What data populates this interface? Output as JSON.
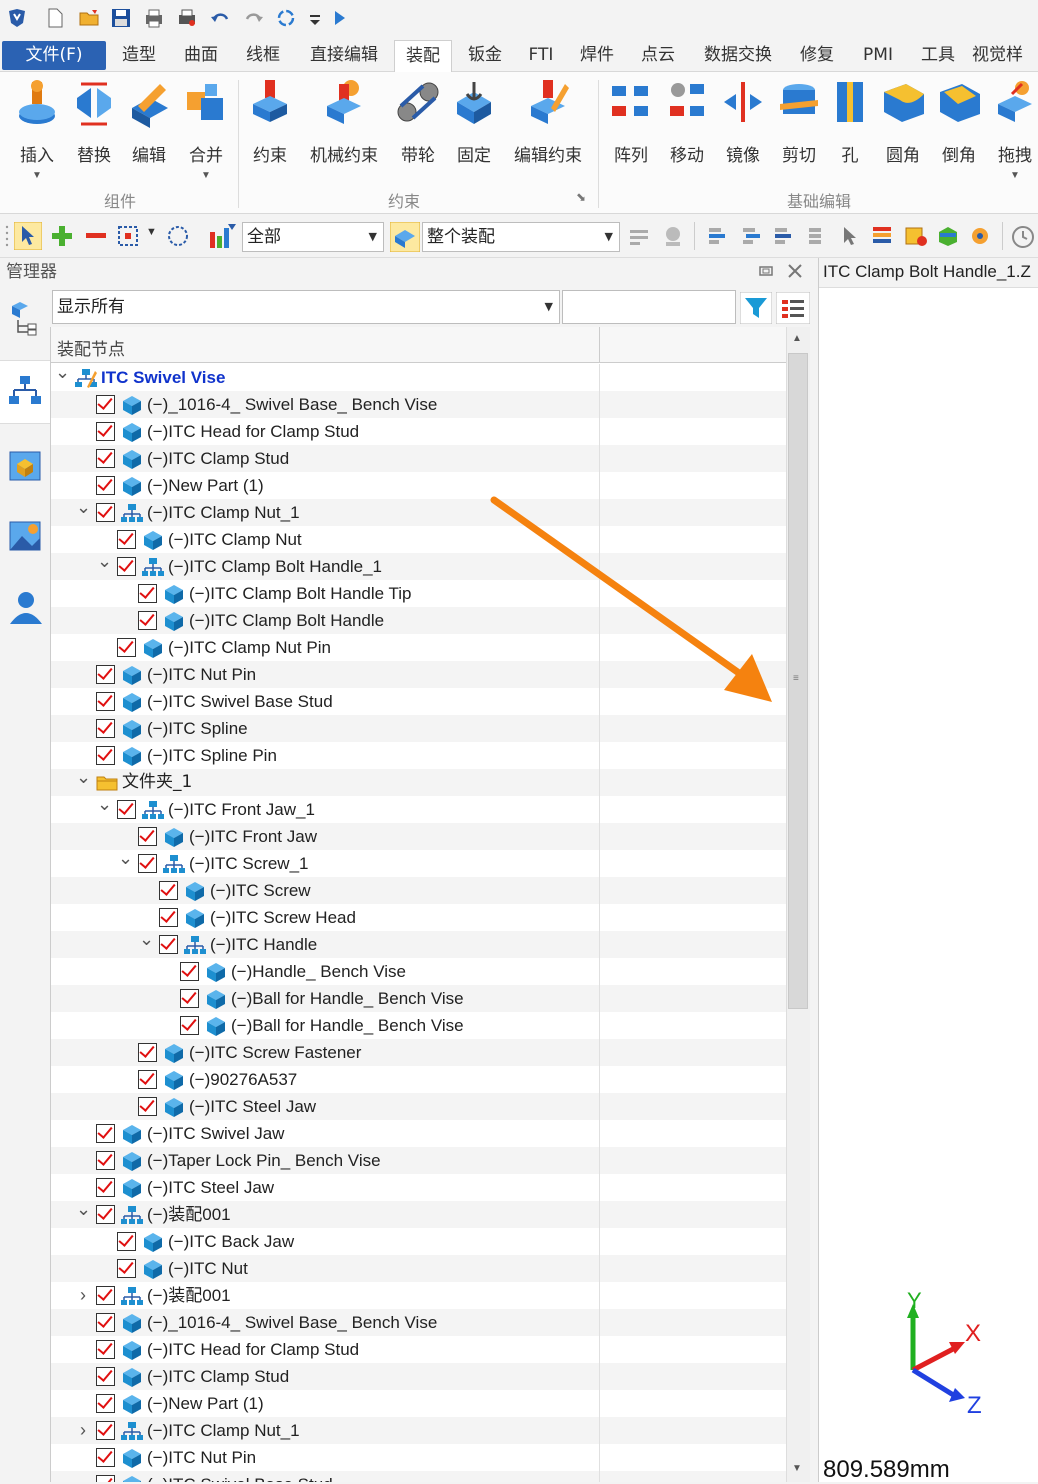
{
  "menu_tabs": [
    "文件(F)",
    "造型",
    "曲面",
    "线框",
    "直接编辑",
    "装配",
    "钣金",
    "FTI",
    "焊件",
    "点云",
    "数据交换",
    "修复",
    "PMI",
    "工具",
    "视觉样"
  ],
  "ribbon": {
    "group_component": {
      "label": "组件",
      "buttons": [
        "插入",
        "替换",
        "编辑",
        "合并"
      ]
    },
    "group_constraint": {
      "label": "约束",
      "buttons": [
        "约束",
        "机械约束",
        "带轮",
        "固定",
        "编辑约束"
      ]
    },
    "group_basic_edit": {
      "label": "基础编辑",
      "buttons": [
        "阵列",
        "移动",
        "镜像",
        "剪切",
        "孔",
        "圆角",
        "倒角",
        "拖拽"
      ]
    }
  },
  "toolbar": {
    "filter_combo": "全部",
    "scope_combo": "整个装配"
  },
  "manager": {
    "title": "管理器",
    "filter_dropdown": "显示所有",
    "column_header": "装配节点"
  },
  "viewport": {
    "tab_title": "ITC Clamp Bolt Handle_1.Z",
    "axis_x": "X",
    "axis_y": "Y",
    "axis_z": "Z",
    "measurement": "809.589mm"
  },
  "tree": [
    {
      "label": "ITC Swivel Vise",
      "level": 0,
      "type": "root",
      "expand": "open"
    },
    {
      "label": "(−)_1016-4_ Swivel Base_ Bench Vise",
      "level": 1,
      "type": "part"
    },
    {
      "label": "(−)ITC Head for Clamp Stud",
      "level": 1,
      "type": "part"
    },
    {
      "label": "(−)ITC Clamp Stud",
      "level": 1,
      "type": "part"
    },
    {
      "label": "(−)New Part (1)",
      "level": 1,
      "type": "part"
    },
    {
      "label": "(−)ITC Clamp Nut_1",
      "level": 1,
      "type": "asm",
      "expand": "open"
    },
    {
      "label": "(−)ITC Clamp Nut",
      "level": 2,
      "type": "part"
    },
    {
      "label": "(−)ITC Clamp Bolt Handle_1",
      "level": 2,
      "type": "asm",
      "expand": "open"
    },
    {
      "label": "(−)ITC Clamp Bolt Handle Tip",
      "level": 3,
      "type": "part"
    },
    {
      "label": "(−)ITC Clamp Bolt Handle",
      "level": 3,
      "type": "part"
    },
    {
      "label": "(−)ITC Clamp Nut Pin",
      "level": 2,
      "type": "part"
    },
    {
      "label": "(−)ITC Nut Pin",
      "level": 1,
      "type": "part"
    },
    {
      "label": "(−)ITC Swivel Base Stud",
      "level": 1,
      "type": "part"
    },
    {
      "label": "(−)ITC Spline",
      "level": 1,
      "type": "part"
    },
    {
      "label": "(−)ITC Spline Pin",
      "level": 1,
      "type": "part"
    },
    {
      "label": "文件夹_1",
      "level": 1,
      "type": "folder",
      "expand": "open"
    },
    {
      "label": "(−)ITC Front Jaw_1",
      "level": 2,
      "type": "asm",
      "expand": "open"
    },
    {
      "label": "(−)ITC Front Jaw",
      "level": 3,
      "type": "part"
    },
    {
      "label": "(−)ITC Screw_1",
      "level": 3,
      "type": "asm",
      "expand": "open"
    },
    {
      "label": "(−)ITC Screw",
      "level": 4,
      "type": "part"
    },
    {
      "label": "(−)ITC Screw Head",
      "level": 4,
      "type": "part"
    },
    {
      "label": "(−)ITC Handle",
      "level": 4,
      "type": "asm",
      "expand": "open"
    },
    {
      "label": "(−)Handle_ Bench Vise",
      "level": 5,
      "type": "part"
    },
    {
      "label": "(−)Ball for Handle_ Bench Vise",
      "level": 5,
      "type": "part"
    },
    {
      "label": "(−)Ball for Handle_ Bench Vise",
      "level": 5,
      "type": "part"
    },
    {
      "label": "(−)ITC Screw Fastener",
      "level": 3,
      "type": "part"
    },
    {
      "label": "(−)90276A537",
      "level": 3,
      "type": "part"
    },
    {
      "label": "(−)ITC Steel Jaw",
      "level": 3,
      "type": "part"
    },
    {
      "label": "(−)ITC Swivel Jaw",
      "level": 1,
      "type": "part"
    },
    {
      "label": "(−)Taper Lock Pin_ Bench Vise",
      "level": 1,
      "type": "part"
    },
    {
      "label": "(−)ITC Steel Jaw",
      "level": 1,
      "type": "part"
    },
    {
      "label": "(−)装配001",
      "level": 1,
      "type": "asm",
      "expand": "open"
    },
    {
      "label": "(−)ITC Back Jaw",
      "level": 2,
      "type": "part"
    },
    {
      "label": "(−)ITC Nut",
      "level": 2,
      "type": "part"
    },
    {
      "label": "(−)装配001",
      "level": 1,
      "type": "asm",
      "expand": "closed"
    },
    {
      "label": "(−)_1016-4_ Swivel Base_ Bench Vise",
      "level": 1,
      "type": "part"
    },
    {
      "label": "(−)ITC Head for Clamp Stud",
      "level": 1,
      "type": "part"
    },
    {
      "label": "(−)ITC Clamp Stud",
      "level": 1,
      "type": "part"
    },
    {
      "label": "(−)New Part (1)",
      "level": 1,
      "type": "part"
    },
    {
      "label": "(−)ITC Clamp Nut_1",
      "level": 1,
      "type": "asm",
      "expand": "closed"
    },
    {
      "label": "(−)ITC Nut Pin",
      "level": 1,
      "type": "part"
    },
    {
      "label": "(−)ITC Swivel Base Stud",
      "level": 1,
      "type": "part"
    }
  ],
  "colors": {
    "file_tab": "#2b62b3",
    "check": "#e01010",
    "part_icon": "#1d8fd0",
    "annotation_arrow": "#f5820f",
    "root_label": "#1033cc"
  }
}
